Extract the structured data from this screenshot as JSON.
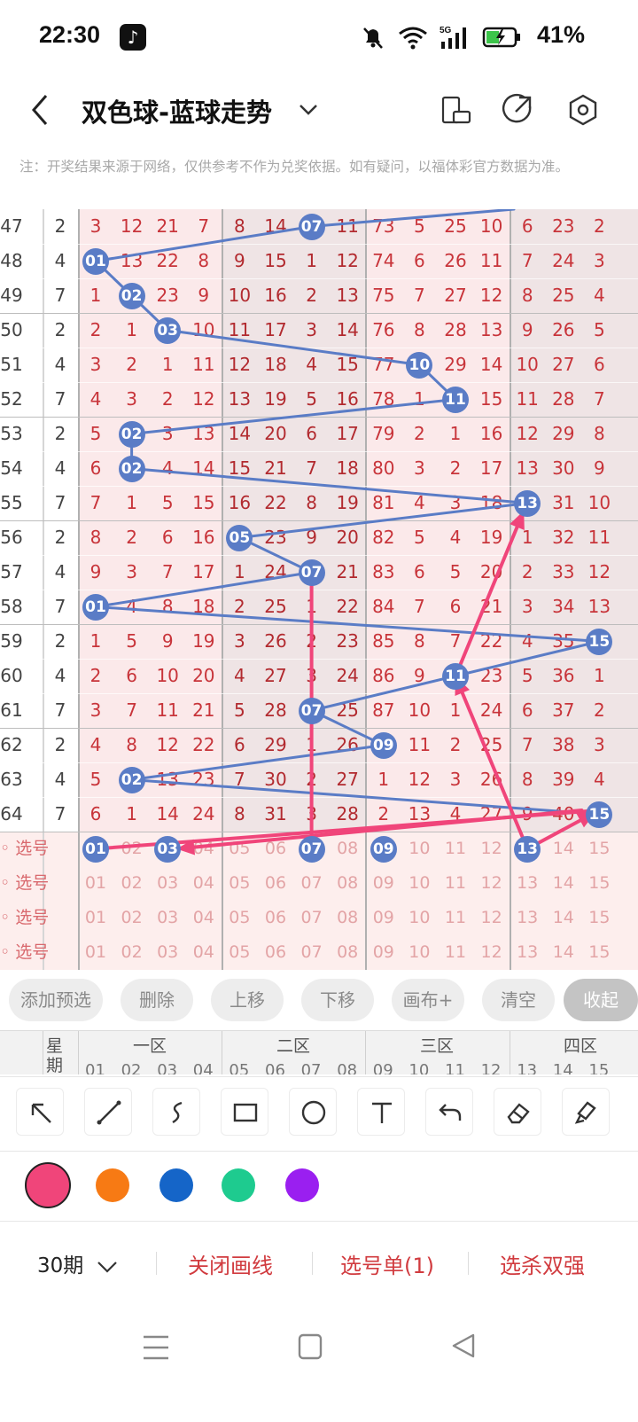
{
  "status_bar": {
    "time": "22:30",
    "network": "5G",
    "battery": "41%"
  },
  "header": {
    "title": "双色球-蓝球走势"
  },
  "notice": "注：开奖结果来源于网络，仅供参考不作为兑奖依据。如有疑问，以福体彩官方数据为准。",
  "chart": {
    "rows": [
      {
        "period": "47",
        "weekday": "2",
        "values": [
          3,
          12,
          21,
          7,
          8,
          14,
          7,
          11,
          73,
          5,
          25,
          10,
          6,
          23,
          2
        ],
        "ball": 7
      },
      {
        "period": "48",
        "weekday": "4",
        "values": [
          1,
          13,
          22,
          8,
          9,
          15,
          1,
          12,
          74,
          6,
          26,
          11,
          7,
          24,
          3
        ],
        "ball": 1
      },
      {
        "period": "49",
        "weekday": "7",
        "values": [
          1,
          2,
          23,
          9,
          10,
          16,
          2,
          13,
          75,
          7,
          27,
          12,
          8,
          25,
          4
        ],
        "ball": 2
      },
      {
        "period": "50",
        "weekday": "2",
        "values": [
          2,
          1,
          3,
          10,
          11,
          17,
          3,
          14,
          76,
          8,
          28,
          13,
          9,
          26,
          5
        ],
        "ball": 3
      },
      {
        "period": "51",
        "weekday": "4",
        "values": [
          3,
          2,
          1,
          11,
          12,
          18,
          4,
          15,
          77,
          10,
          29,
          14,
          10,
          27,
          6
        ],
        "ball": 10
      },
      {
        "period": "52",
        "weekday": "7",
        "values": [
          4,
          3,
          2,
          12,
          13,
          19,
          5,
          16,
          78,
          1,
          11,
          15,
          11,
          28,
          7
        ],
        "ball": 11
      },
      {
        "period": "53",
        "weekday": "2",
        "values": [
          5,
          2,
          3,
          13,
          14,
          20,
          6,
          17,
          79,
          2,
          1,
          16,
          12,
          29,
          8
        ],
        "ball": 2
      },
      {
        "period": "54",
        "weekday": "4",
        "values": [
          6,
          2,
          4,
          14,
          15,
          21,
          7,
          18,
          80,
          3,
          2,
          17,
          13,
          30,
          9
        ],
        "ball": 2
      },
      {
        "period": "55",
        "weekday": "7",
        "values": [
          7,
          1,
          5,
          15,
          16,
          22,
          8,
          19,
          81,
          4,
          3,
          18,
          13,
          31,
          10
        ],
        "ball": 13
      },
      {
        "period": "56",
        "weekday": "2",
        "values": [
          8,
          2,
          6,
          16,
          5,
          23,
          9,
          20,
          82,
          5,
          4,
          19,
          1,
          32,
          11
        ],
        "ball": 5
      },
      {
        "period": "57",
        "weekday": "4",
        "values": [
          9,
          3,
          7,
          17,
          1,
          24,
          7,
          21,
          83,
          6,
          5,
          20,
          2,
          33,
          12
        ],
        "ball": 7
      },
      {
        "period": "58",
        "weekday": "7",
        "values": [
          1,
          4,
          8,
          18,
          2,
          25,
          1,
          22,
          84,
          7,
          6,
          21,
          3,
          34,
          13
        ],
        "ball": 1
      },
      {
        "period": "59",
        "weekday": "2",
        "values": [
          1,
          5,
          9,
          19,
          3,
          26,
          2,
          23,
          85,
          8,
          7,
          22,
          4,
          35,
          15
        ],
        "ball": 15
      },
      {
        "period": "60",
        "weekday": "4",
        "values": [
          2,
          6,
          10,
          20,
          4,
          27,
          3,
          24,
          86,
          9,
          11,
          23,
          5,
          36,
          1
        ],
        "ball": 11
      },
      {
        "period": "61",
        "weekday": "7",
        "values": [
          3,
          7,
          11,
          21,
          5,
          28,
          7,
          25,
          87,
          10,
          1,
          24,
          6,
          37,
          2
        ],
        "ball": 7
      },
      {
        "period": "62",
        "weekday": "2",
        "values": [
          4,
          8,
          12,
          22,
          6,
          29,
          1,
          26,
          9,
          11,
          2,
          25,
          7,
          38,
          3
        ],
        "ball": 9
      },
      {
        "period": "63",
        "weekday": "4",
        "values": [
          5,
          2,
          13,
          23,
          7,
          30,
          2,
          27,
          1,
          12,
          3,
          26,
          8,
          39,
          4
        ],
        "ball": 2
      },
      {
        "period": "64",
        "weekday": "7",
        "values": [
          6,
          1,
          14,
          24,
          8,
          31,
          3,
          28,
          2,
          13,
          4,
          27,
          9,
          40,
          15
        ],
        "ball": 15
      }
    ],
    "select_label": "选号",
    "select_numbers": [
      "01",
      "02",
      "03",
      "04",
      "05",
      "06",
      "07",
      "08",
      "09",
      "10",
      "11",
      "12",
      "13",
      "14",
      "15"
    ],
    "selected_first_row": [
      "01",
      "03",
      "07",
      "09",
      "13"
    ]
  },
  "actions": [
    "添加预选",
    "删除",
    "上移",
    "下移",
    "画布+",
    "清空",
    "收起"
  ],
  "table_header": {
    "weekday": "星期",
    "zones": [
      "一区",
      "二区",
      "三区",
      "四区"
    ],
    "columns": [
      "01",
      "02",
      "03",
      "04",
      "05",
      "06",
      "07",
      "08",
      "09",
      "10",
      "11",
      "12",
      "13",
      "14",
      "15"
    ]
  },
  "tools": [
    "arrow-tool",
    "line-tool",
    "curve-tool",
    "rectangle-tool",
    "circle-tool",
    "text-tool",
    "undo-tool",
    "eraser-tool",
    "clear-tool"
  ],
  "colors": [
    "#f0457a",
    "#f77a14",
    "#1565c8",
    "#1ecb8f",
    "#9a1ff0"
  ],
  "bottom": {
    "periods": "30期",
    "close_draw": "关闭画线",
    "selection": "选号单(1)",
    "kill": "选杀双强"
  }
}
